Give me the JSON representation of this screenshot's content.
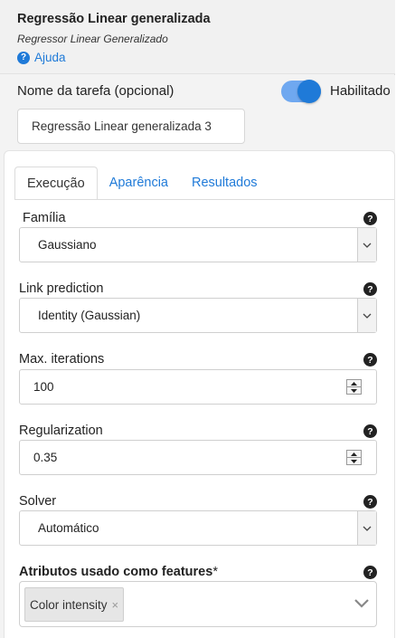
{
  "header": {
    "title": "Regressão Linear generalizada",
    "subtitle": "Regressor Linear Generalizado",
    "help_label": "Ajuda"
  },
  "task": {
    "label": "Nome da tarefa (opcional)",
    "name_value": "Regressão Linear generalizada 3",
    "enabled_label": "Habilitado",
    "enabled": true
  },
  "tabs": [
    {
      "label": "Execução",
      "active": true
    },
    {
      "label": "Aparência",
      "active": false
    },
    {
      "label": "Resultados",
      "active": false
    }
  ],
  "fields": {
    "family": {
      "label": "Família",
      "value": "Gaussiano"
    },
    "link": {
      "label": "Link prediction",
      "value": "Identity (Gaussian)"
    },
    "max_iter": {
      "label": "Max. iterations",
      "value": "100"
    },
    "regularization": {
      "label": "Regularization",
      "value": "0.35"
    },
    "solver": {
      "label": "Solver",
      "value": "Automático"
    },
    "features": {
      "label": "Atributos usado como features",
      "required_mark": "*",
      "chips": [
        "Color intensity"
      ],
      "chip_remove": "×"
    }
  },
  "icons": {
    "help": "question-circle-icon",
    "dropdown": "chevron-down-icon",
    "spinner": "spin-arrows-icon"
  },
  "colors": {
    "accent": "#1f7ad8",
    "toggle_track": "#6fa8f0"
  }
}
